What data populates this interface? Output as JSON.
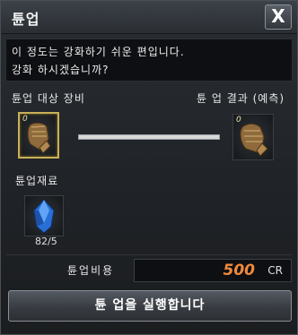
{
  "window": {
    "title": "튠업",
    "close_label": "X"
  },
  "message": {
    "line1": "이 정도는 강화하기 쉬운 편입니다.",
    "line2": "강화 하시겠습니까?"
  },
  "labels": {
    "target_equipment": "튠업 대상 장비",
    "result_preview": "튠 업 결과 (예측)",
    "materials": "튠업재료",
    "cost": "튠업비용"
  },
  "slots": {
    "target": {
      "icon": "leather-glove-icon",
      "level": "0",
      "selected": true
    },
    "result": {
      "icon": "leather-glove-icon",
      "level": "0"
    },
    "material": {
      "icon": "blue-crystal-icon",
      "count": "82/5"
    }
  },
  "progress": {
    "value": 1.0
  },
  "cost": {
    "value": "500",
    "unit": "CR",
    "color": "#f08a3c"
  },
  "action": {
    "label": "튠 업을 실행합니다"
  }
}
